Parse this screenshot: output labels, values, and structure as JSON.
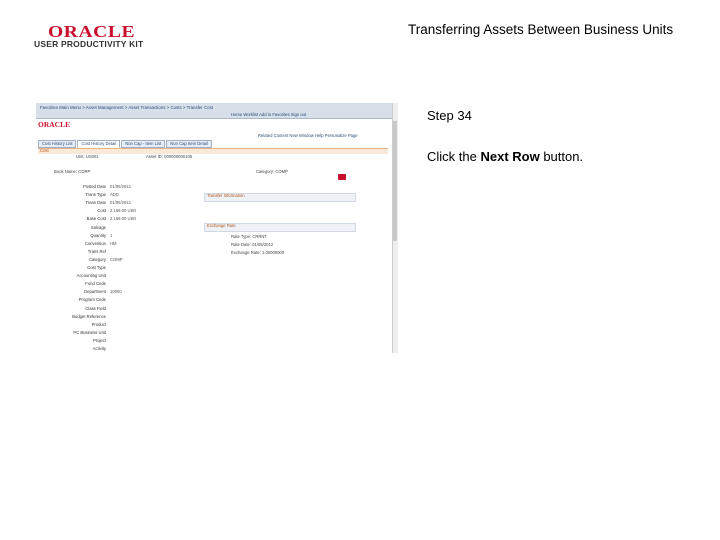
{
  "header": {
    "logo_oracle": "ORACLE",
    "logo_upk": "USER PRODUCTIVITY KIT",
    "page_title": "Transferring Assets Between Business Units"
  },
  "step": {
    "title": "Step 34",
    "instruction_pre": "Click the ",
    "instruction_bold": "Next Row",
    "instruction_post": " button."
  },
  "screenshot": {
    "nav_items": "Favorites   Main Menu   >   Asset Management   >   Asset Transactions   >   Costs   >   Transfer Cost",
    "menu_items": "Home    Worklist    Add to Favorites    Sign out",
    "logo": "ORACLE",
    "related": "Related Content   New Window   Help   Personalize Page",
    "tabs": [
      "Cost History List",
      "Cost History Detail",
      "Non Cap - Item List",
      "Non Cap Item Detail"
    ],
    "cost_label": "Cost",
    "unit_label": "Unit:",
    "unit_value": "US001",
    "asset_label": "Asset ID:",
    "asset_value": "000000000105",
    "book_label": "Book Name:",
    "book_value": "CORP",
    "category_label": "Category:",
    "category_value": "COMP",
    "fields": [
      {
        "label": "Posted Date",
        "value": "01/05/2012"
      },
      {
        "label": "Trans Type",
        "value": "ADD"
      },
      {
        "label": "Trans Date",
        "value": "01/05/2012"
      },
      {
        "label": "Cost",
        "value": "2,169.00 USD"
      },
      {
        "label": "Base Cost",
        "value": "2,169.00 USD"
      },
      {
        "label": "Salvage",
        "value": ""
      },
      {
        "label": "Quantity",
        "value": "1"
      },
      {
        "label": "Convention",
        "value": "HM"
      },
      {
        "label": "Trans Ref",
        "value": ""
      },
      {
        "label": "Category",
        "value": "COMP"
      },
      {
        "label": "Cost Type",
        "value": ""
      },
      {
        "label": "Accounting Unit",
        "value": ""
      },
      {
        "label": "Fund Code",
        "value": ""
      },
      {
        "label": "Department",
        "value": "10000"
      },
      {
        "label": "Program Code",
        "value": ""
      },
      {
        "label": "Class Field",
        "value": ""
      },
      {
        "label": "Budget Reference",
        "value": ""
      },
      {
        "label": "Product",
        "value": ""
      },
      {
        "label": "PC Business Unit",
        "value": ""
      },
      {
        "label": "Project",
        "value": ""
      },
      {
        "label": "Activity",
        "value": ""
      }
    ],
    "panel1": "Transfer Information",
    "panel2": "Exchange Rate",
    "panel2_rows": [
      "Rate Type: CRRNT",
      "Rate Date: 01/05/2012",
      "Exchange Rate: 1.00000000"
    ]
  }
}
